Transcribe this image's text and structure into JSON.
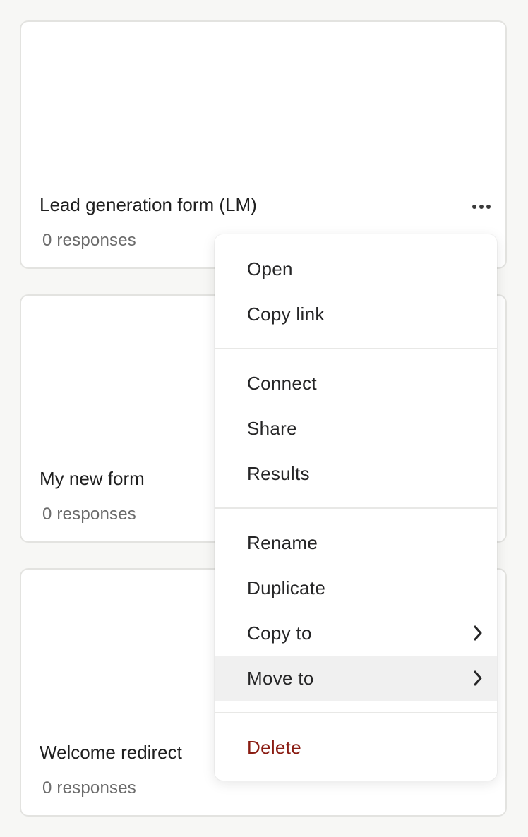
{
  "cards": [
    {
      "title": "Lead generation form (LM)",
      "responses": "0 responses"
    },
    {
      "title": "My new form",
      "responses": "0 responses"
    },
    {
      "title": "Welcome redirect",
      "responses": "0 responses"
    }
  ],
  "more_icon": "more-horizontal-icon",
  "menu": {
    "group1": {
      "open": "Open",
      "copy_link": "Copy link"
    },
    "group2": {
      "connect": "Connect",
      "share": "Share",
      "results": "Results"
    },
    "group3": {
      "rename": "Rename",
      "duplicate": "Duplicate",
      "copy_to": "Copy to",
      "move_to": "Move to"
    },
    "group4": {
      "delete": "Delete"
    },
    "submenu_icon": "chevron-right-icon",
    "active_item": "Move to"
  },
  "colors": {
    "background": "#f7f7f5",
    "card": "#ffffff",
    "card_border": "#e3e3e0",
    "delete": "#8a1c12",
    "active_row": "#f0f0f0"
  }
}
